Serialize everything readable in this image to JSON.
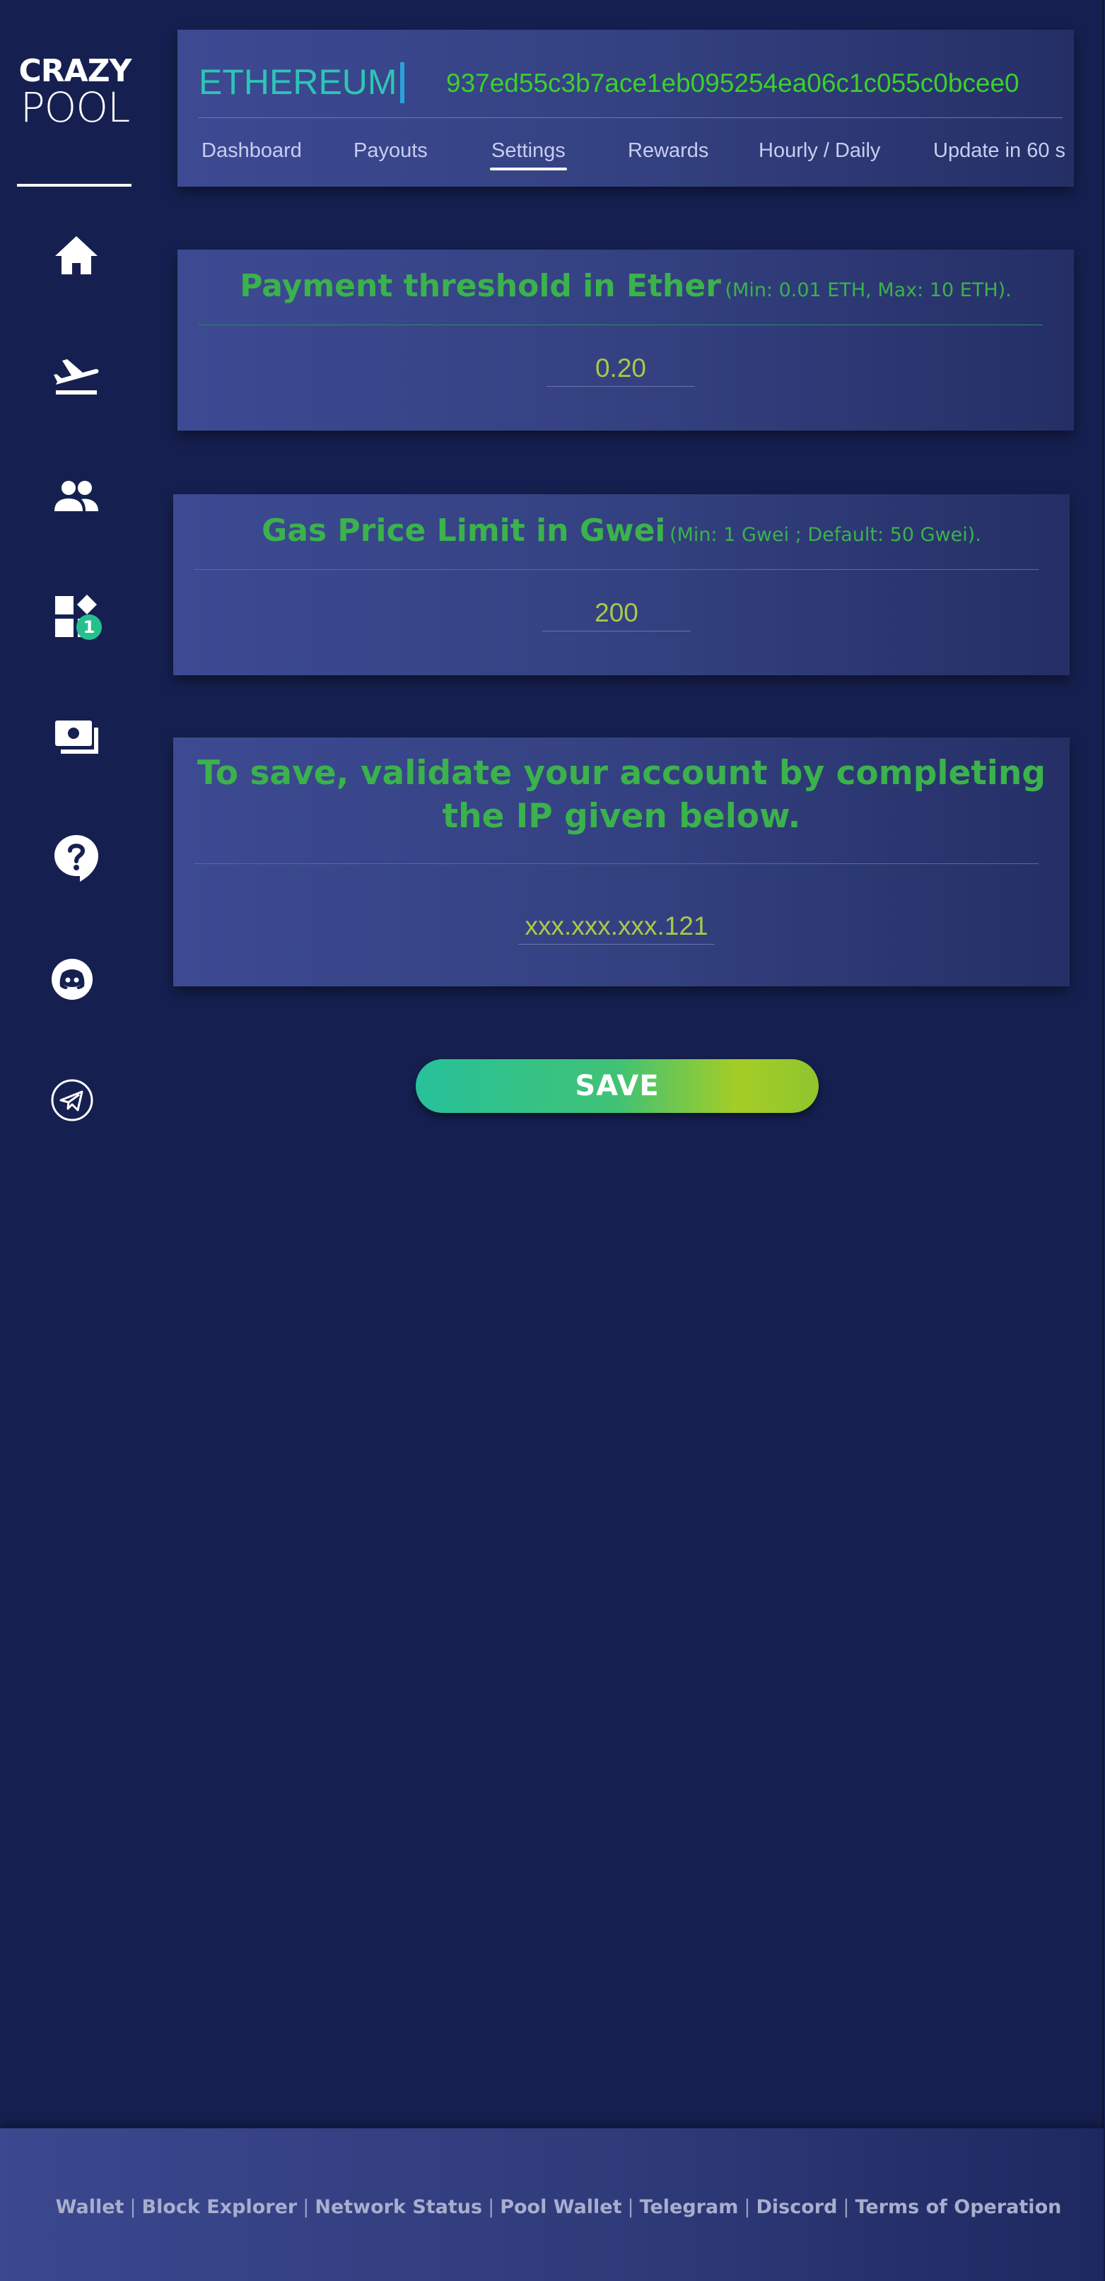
{
  "logo": {
    "top": "CRAZY",
    "bottom": "POOL"
  },
  "sidebar": {
    "items": [
      {
        "icon": "home-icon"
      },
      {
        "icon": "plane-departure-icon"
      },
      {
        "icon": "users-icon"
      },
      {
        "icon": "widgets-icon",
        "badge": "1"
      },
      {
        "icon": "money-icon"
      },
      {
        "icon": "help-bubble-icon"
      },
      {
        "icon": "discord-icon"
      },
      {
        "icon": "telegram-icon"
      }
    ]
  },
  "header": {
    "coin": "ETHEREUM",
    "address": "937ed55c3b7ace1eb095254ea06c1c055c0bcee0",
    "tabs": [
      "Dashboard",
      "Payouts",
      "Settings",
      "Rewards",
      "Hourly / Daily",
      "Update in 60 s"
    ],
    "active_tab": "Settings"
  },
  "threshold": {
    "title": "Payment threshold in Ether",
    "note": "(Min: 0.01 ETH, Max: 10 ETH).",
    "value": "0.20"
  },
  "gas": {
    "title": "Gas Price Limit in Gwei",
    "note": "(Min: 1 Gwei ; Default: 50 Gwei).",
    "value": "200"
  },
  "ip_validation": {
    "title": "To save, validate your account by completing the IP given below.",
    "value": "xxx.xxx.xxx.121"
  },
  "save_label": "SAVE",
  "footer": {
    "links": [
      "Wallet",
      "Block Explorer",
      "Network Status",
      "Pool Wallet",
      "Telegram",
      "Discord",
      "Terms of Operation"
    ],
    "separator": "|"
  },
  "colors": {
    "background": "#162050",
    "card": "#3d4a93",
    "accent_green": "#3bb24c",
    "coin_teal": "#2ec4b6",
    "address_green": "#3ad12b",
    "input_text": "#a9c94a",
    "badge": "#26c08f"
  }
}
